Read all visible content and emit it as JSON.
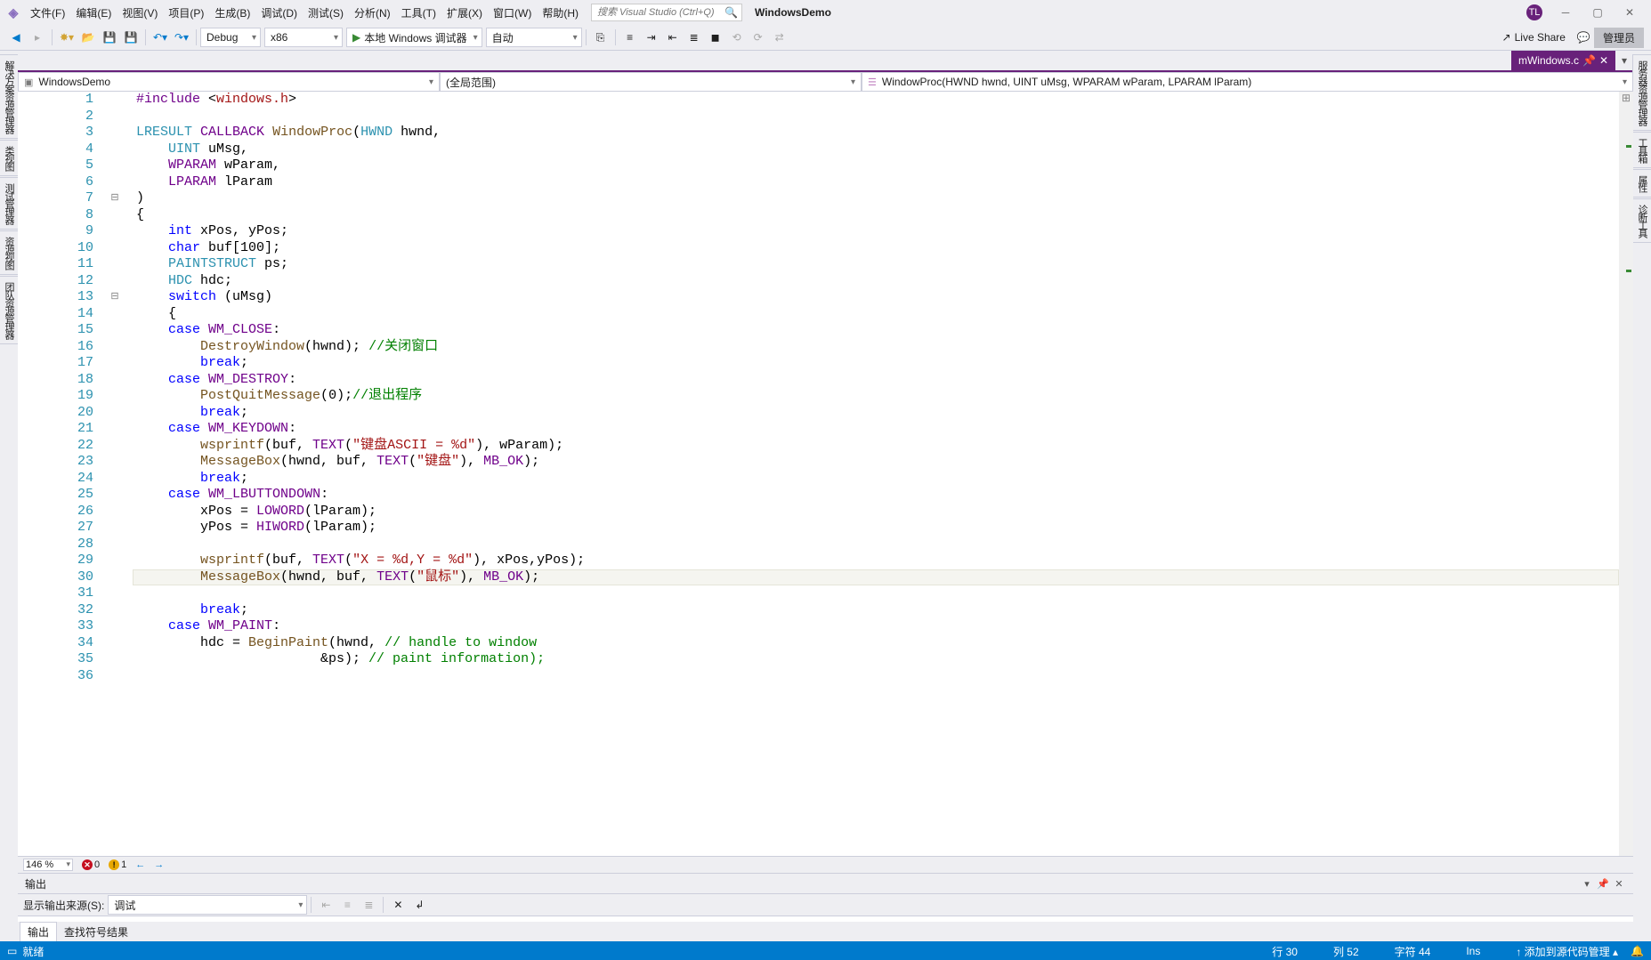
{
  "menu": {
    "file": "文件(F)",
    "edit": "编辑(E)",
    "view": "视图(V)",
    "project": "项目(P)",
    "build": "生成(B)",
    "debug": "调试(D)",
    "test": "测试(S)",
    "analyze": "分析(N)",
    "tools": "工具(T)",
    "extensions": "扩展(X)",
    "window": "窗口(W)",
    "help": "帮助(H)"
  },
  "search": {
    "placeholder": "搜索 Visual Studio (Ctrl+Q)"
  },
  "solution_name": "WindowsDemo",
  "avatar": "TL",
  "toolbar": {
    "config": "Debug",
    "platform": "x86",
    "start_label": "本地 Windows 调试器",
    "auto": "自动",
    "live_share": "Live Share",
    "admin": "管理员"
  },
  "tab": {
    "name": "mWindows.c",
    "pinned": "⁕"
  },
  "nav": {
    "project": "WindowsDemo",
    "scope": "(全局范围)",
    "member": "WindowProc(HWND hwnd, UINT uMsg, WPARAM wParam, LPARAM lParam)"
  },
  "left_tabs": [
    "解决方案资源管理器",
    "类视图",
    "测试管理器",
    "资源视图",
    "团队资源管理器"
  ],
  "right_tabs": [
    "服务器资源管理器",
    "工具箱",
    "属性",
    "诊断工具"
  ],
  "zoom": "146 %",
  "errors": {
    "errors": "0",
    "warnings": "1"
  },
  "output": {
    "title": "输出",
    "source_label": "显示输出来源(S):",
    "source_value": "调试"
  },
  "bottom_tabs": {
    "output": "输出",
    "find": "查找符号结果"
  },
  "status": {
    "ready": "就绪",
    "line": "行 30",
    "col": "列 52",
    "char": "字符 44",
    "ins": "Ins",
    "source_control": "添加到源代码管理"
  },
  "code": {
    "start_line": 1,
    "current_line": 30,
    "lines": [
      {
        "t": [
          [
            "mc",
            "#include"
          ],
          [
            "p",
            " <"
          ],
          [
            "s",
            "windows.h"
          ],
          [
            "p",
            ">"
          ]
        ]
      },
      {
        "t": []
      },
      {
        "t": [
          [
            "ty",
            "LRESULT"
          ],
          [
            "p",
            " "
          ],
          [
            "mc",
            "CALLBACK"
          ],
          [
            "p",
            " "
          ],
          [
            "fn",
            "WindowProc"
          ],
          [
            "p",
            "("
          ],
          [
            "ty",
            "HWND"
          ],
          [
            "p",
            " hwnd,"
          ]
        ]
      },
      {
        "t": [
          [
            "p",
            "    "
          ],
          [
            "ty",
            "UINT"
          ],
          [
            "p",
            " uMsg,"
          ]
        ]
      },
      {
        "t": [
          [
            "p",
            "    "
          ],
          [
            "mc",
            "WPARAM"
          ],
          [
            "p",
            " wParam,"
          ]
        ]
      },
      {
        "t": [
          [
            "p",
            "    "
          ],
          [
            "mc",
            "LPARAM"
          ],
          [
            "p",
            " lParam"
          ]
        ]
      },
      {
        "fold": "⊟",
        "t": [
          [
            "p",
            ")"
          ]
        ]
      },
      {
        "t": [
          [
            "p",
            "{"
          ]
        ]
      },
      {
        "t": [
          [
            "p",
            "    "
          ],
          [
            "kw",
            "int"
          ],
          [
            "p",
            " xPos, yPos;"
          ]
        ]
      },
      {
        "t": [
          [
            "p",
            "    "
          ],
          [
            "kw",
            "char"
          ],
          [
            "p",
            " buf["
          ],
          [
            "n",
            "100"
          ],
          [
            "p",
            "];"
          ]
        ]
      },
      {
        "t": [
          [
            "p",
            "    "
          ],
          [
            "ty",
            "PAINTSTRUCT"
          ],
          [
            "p",
            " ps;"
          ]
        ]
      },
      {
        "t": [
          [
            "p",
            "    "
          ],
          [
            "ty",
            "HDC"
          ],
          [
            "p",
            " hdc;"
          ]
        ]
      },
      {
        "fold": "⊟",
        "t": [
          [
            "p",
            "    "
          ],
          [
            "kw",
            "switch"
          ],
          [
            "p",
            " (uMsg)"
          ]
        ]
      },
      {
        "t": [
          [
            "p",
            "    {"
          ]
        ]
      },
      {
        "t": [
          [
            "p",
            "    "
          ],
          [
            "kw",
            "case"
          ],
          [
            "p",
            " "
          ],
          [
            "mc",
            "WM_CLOSE"
          ],
          [
            "p",
            ":"
          ]
        ]
      },
      {
        "t": [
          [
            "p",
            "        "
          ],
          [
            "fn",
            "DestroyWindow"
          ],
          [
            "p",
            "(hwnd); "
          ],
          [
            "cm",
            "//关闭窗口"
          ]
        ]
      },
      {
        "t": [
          [
            "p",
            "        "
          ],
          [
            "kw",
            "break"
          ],
          [
            "p",
            ";"
          ]
        ]
      },
      {
        "t": [
          [
            "p",
            "    "
          ],
          [
            "kw",
            "case"
          ],
          [
            "p",
            " "
          ],
          [
            "mc",
            "WM_DESTROY"
          ],
          [
            "p",
            ":"
          ]
        ]
      },
      {
        "t": [
          [
            "p",
            "        "
          ],
          [
            "fn",
            "PostQuitMessage"
          ],
          [
            "p",
            "("
          ],
          [
            "n",
            "0"
          ],
          [
            "p",
            ");"
          ],
          [
            "cm",
            "//退出程序"
          ]
        ]
      },
      {
        "t": [
          [
            "p",
            "        "
          ],
          [
            "kw",
            "break"
          ],
          [
            "p",
            ";"
          ]
        ]
      },
      {
        "t": [
          [
            "p",
            "    "
          ],
          [
            "kw",
            "case"
          ],
          [
            "p",
            " "
          ],
          [
            "mc",
            "WM_KEYDOWN"
          ],
          [
            "p",
            ":"
          ]
        ]
      },
      {
        "t": [
          [
            "p",
            "        "
          ],
          [
            "fn",
            "wsprintf"
          ],
          [
            "p",
            "(buf, "
          ],
          [
            "mc",
            "TEXT"
          ],
          [
            "p",
            "("
          ],
          [
            "s",
            "\"键盘ASCII = %d\""
          ],
          [
            "p",
            "), wParam);"
          ]
        ]
      },
      {
        "t": [
          [
            "p",
            "        "
          ],
          [
            "fn",
            "MessageBox"
          ],
          [
            "p",
            "(hwnd, buf, "
          ],
          [
            "mc",
            "TEXT"
          ],
          [
            "p",
            "("
          ],
          [
            "s",
            "\"键盘\""
          ],
          [
            "p",
            "), "
          ],
          [
            "mc",
            "MB_OK"
          ],
          [
            "p",
            ");"
          ]
        ]
      },
      {
        "t": [
          [
            "p",
            "        "
          ],
          [
            "kw",
            "break"
          ],
          [
            "p",
            ";"
          ]
        ]
      },
      {
        "t": [
          [
            "p",
            "    "
          ],
          [
            "kw",
            "case"
          ],
          [
            "p",
            " "
          ],
          [
            "mc",
            "WM_LBUTTONDOWN"
          ],
          [
            "p",
            ":"
          ]
        ]
      },
      {
        "t": [
          [
            "p",
            "        xPos = "
          ],
          [
            "mc",
            "LOWORD"
          ],
          [
            "p",
            "(lParam);"
          ]
        ]
      },
      {
        "t": [
          [
            "p",
            "        yPos = "
          ],
          [
            "mc",
            "HIWORD"
          ],
          [
            "p",
            "(lParam);"
          ]
        ]
      },
      {
        "t": []
      },
      {
        "t": [
          [
            "p",
            "        "
          ],
          [
            "fn",
            "wsprintf"
          ],
          [
            "p",
            "(buf, "
          ],
          [
            "mc",
            "TEXT"
          ],
          [
            "p",
            "("
          ],
          [
            "s",
            "\"X = %d,Y = %d\""
          ],
          [
            "p",
            "), xPos,yPos);"
          ]
        ]
      },
      {
        "t": [
          [
            "p",
            "        "
          ],
          [
            "fn",
            "MessageBox"
          ],
          [
            "p",
            "(hwnd, buf, "
          ],
          [
            "mc",
            "TEXT"
          ],
          [
            "p",
            "("
          ],
          [
            "s",
            "\"鼠标\""
          ],
          [
            "p",
            "), "
          ],
          [
            "mc",
            "MB_OK"
          ],
          [
            "p",
            ");"
          ]
        ]
      },
      {
        "t": []
      },
      {
        "t": [
          [
            "p",
            "        "
          ],
          [
            "kw",
            "break"
          ],
          [
            "p",
            ";"
          ]
        ]
      },
      {
        "t": [
          [
            "p",
            "    "
          ],
          [
            "kw",
            "case"
          ],
          [
            "p",
            " "
          ],
          [
            "mc",
            "WM_PAINT"
          ],
          [
            "p",
            ":"
          ]
        ]
      },
      {
        "t": [
          [
            "p",
            "        hdc = "
          ],
          [
            "fn",
            "BeginPaint"
          ],
          [
            "p",
            "(hwnd, "
          ],
          [
            "cm",
            "// handle to window"
          ]
        ]
      },
      {
        "t": [
          [
            "p",
            "                       &ps); "
          ],
          [
            "cm",
            "// paint information);"
          ]
        ]
      },
      {
        "t": []
      }
    ]
  }
}
